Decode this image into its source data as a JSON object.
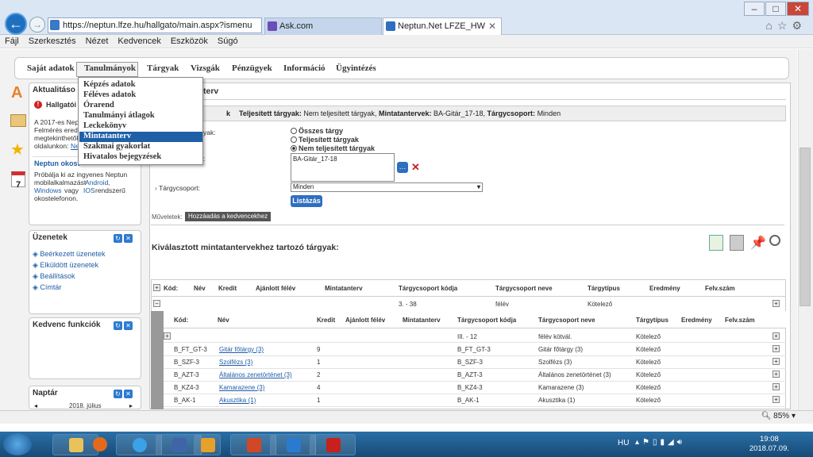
{
  "browser": {
    "url": "https://neptun.lfze.hu/hallgato/main.aspx?ismenu",
    "tabs": [
      {
        "label": "Ask.com"
      },
      {
        "label": "Neptun.Net LFZE_HW"
      }
    ],
    "menu": [
      "Fájl",
      "Szerkesztés",
      "Nézet",
      "Kedvencek",
      "Eszközök",
      "Súgó"
    ],
    "window_controls": {
      "minimize": "–",
      "maximize": "□",
      "close": "✕"
    },
    "zoom": "85%"
  },
  "topnav": {
    "items": [
      "Saját adatok",
      "Tanulmányok",
      "Tárgyak",
      "Vizsgák",
      "Pénzügyek",
      "Információ",
      "Ügyintézés"
    ]
  },
  "dropdown": {
    "items": [
      "Képzés adatok",
      "Féléves adatok",
      "Órarend",
      "Tanulmányi átlagok",
      "Leckekönyv",
      "Mintatanterv",
      "Szakmai gyakorlat",
      "Hivatalos bejegyzések"
    ],
    "selected": "Mintatanterv"
  },
  "sidebar": {
    "news": {
      "title": "Aktualitáso",
      "alert": "Hallgatói",
      "text": [
        "A 2017-es Nept",
        "Felmérés eredm",
        "megtekinthetők",
        "oldalunkon:"
      ],
      "link": "Ne",
      "app_title": "Neptun okost",
      "app_text": [
        "Próbálja ki az ingyenes Neptun",
        "mobilalkalmazást",
        "vagy",
        "rendszerű",
        "okostelefonon."
      ],
      "android": "Android,",
      "windows": "Windows",
      "ios": "IOS"
    },
    "messages": {
      "title": "Üzenetek",
      "links": [
        "Beérkezett üzenetek",
        "Elküldött üzenetek",
        "Beállítások",
        "Címtár"
      ]
    },
    "favorites": {
      "title": "Kedvenc funkciók"
    },
    "calendar": {
      "title": "Naptár",
      "month": "2018. július"
    }
  },
  "main": {
    "page_title": "terv",
    "filter_code": "k",
    "filter_summary": {
      "label1": "Teljesített tárgyak:",
      "value1": "Nem teljesített tárgyak,",
      "label2": "Mintatantervek:",
      "value2": "BA-Gitár_17-18,",
      "label3": "Tárgycsoport:",
      "value3": "Minden"
    },
    "filter_label_partial": "yak:",
    "mt_label_partial": ":",
    "radios": [
      "Összes tárgy",
      "Teljesített tárgyak",
      "Nem teljesített tárgyak"
    ],
    "selected_radio": 2,
    "curriculum": "BA-Gitár_17-18",
    "group_label": "Tárgycsoport:",
    "group_value": "Minden",
    "list_button": "Listázás",
    "ops_label": "Műveletek:",
    "fav_button": "Hozzáadás a kedvencekhez",
    "table_title": "Kiválasztott mintatantervekhez tartozó tárgyak:"
  },
  "table": {
    "outer_headers": [
      "Kód:",
      "Név",
      "Kredit",
      "Ajánlott félév",
      "Mintatanterv",
      "Tárgycsoport kódja",
      "Tárgycsoport neve",
      "Tárgytípus",
      "Eredmény",
      "Felv.szám"
    ],
    "outer_row": {
      "code": "3. - 38",
      "name": "félév",
      "type": "Kötelező"
    },
    "inner_headers": [
      "Kód:",
      "Név",
      "Kredit",
      "Ajánlott félév",
      "Mintatanterv",
      "Tárgycsoport kódja",
      "Tárgycsoport neve",
      "Tárgytípus",
      "Eredmény",
      "Felv.szám"
    ],
    "inner_group": {
      "code": "III. - 12",
      "name": "félév kötvál.",
      "type": "Kötelező"
    },
    "rows": [
      {
        "code": "B_FT_GT-3",
        "name": "Gitár főtárgy (3)",
        "credit": "9",
        "group_code": "B_FT_GT-3",
        "group_name": "Gitár főtárgy (3)",
        "type": "Kötelező"
      },
      {
        "code": "B_SZF-3",
        "name": "Szolfézs (3)",
        "credit": "1",
        "group_code": "B_SZF-3",
        "group_name": "Szolfézs (3)",
        "type": "Kötelező"
      },
      {
        "code": "B_AZT-3",
        "name": "Általános zenetörténet (3)",
        "credit": "2",
        "group_code": "B_AZT-3",
        "group_name": "Általános zenetörténet (3)",
        "type": "Kötelező"
      },
      {
        "code": "B_KZ4-3",
        "name": "Kamarazene (3)",
        "credit": "4",
        "group_code": "B_KZ4-3",
        "group_name": "Kamarazene (3)",
        "type": "Kötelező"
      },
      {
        "code": "B_AK-1",
        "name": "Akusztika (1)",
        "credit": "1",
        "group_code": "B_AK-1",
        "group_name": "Akusztika (1)",
        "type": "Kötelező"
      }
    ]
  },
  "taskbar": {
    "lang": "HU",
    "time": "19:08",
    "date": "2018.07.09."
  }
}
